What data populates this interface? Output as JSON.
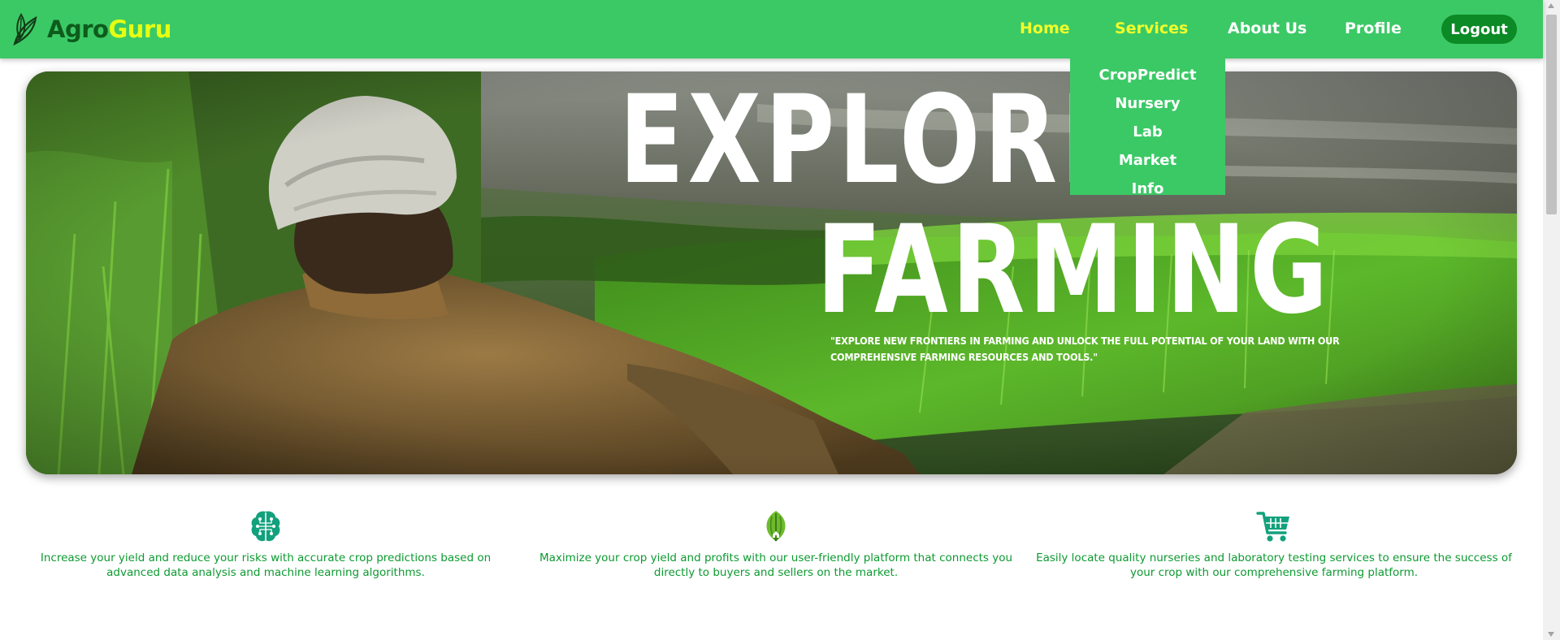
{
  "brand": {
    "part1": "Agro",
    "part2": "Guru"
  },
  "nav": {
    "home": "Home",
    "services": "Services",
    "about": "About Us",
    "profile": "Profile",
    "logout": "Logout"
  },
  "services_menu": [
    "CropPredict",
    "Nursery",
    "Lab",
    "Market",
    "Info"
  ],
  "hero": {
    "title_line1": "EXPLORE",
    "title_line2": "FARMING",
    "quote": "\"Explore new frontiers in farming and unlock the full potential of your land with our comprehensive farming resources and tools.\""
  },
  "features": [
    {
      "icon": "brain-circuit-icon",
      "text": "Increase your yield and reduce your risks with accurate crop predictions based on advanced data analysis and machine learning algorithms."
    },
    {
      "icon": "leaf-house-icon",
      "text": "Maximize your crop yield and profits with our user-friendly platform that connects you directly to buyers and sellers on the market."
    },
    {
      "icon": "shopping-cart-icon",
      "text": "Easily locate quality nurseries and laboratory testing services to ensure the success of your crop with our comprehensive farming platform."
    }
  ],
  "colors": {
    "nav_bg": "#3bc966",
    "active_link": "#f2ff2a",
    "logout_bg": "#0b8a25",
    "feature_text": "#0c9a30",
    "feature_icon": "#12a17c"
  }
}
